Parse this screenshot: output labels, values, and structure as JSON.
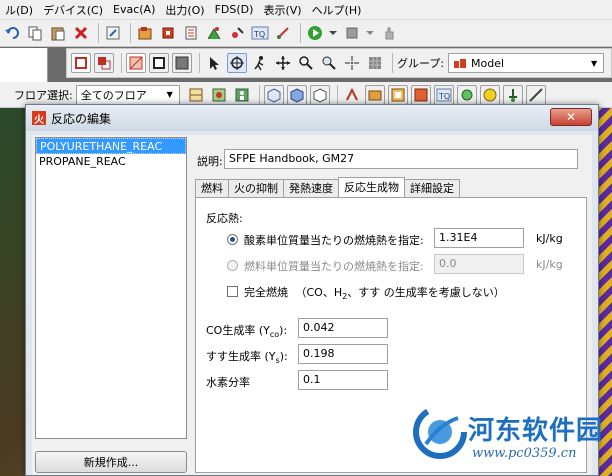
{
  "menu": [
    "ル(D)",
    "デバイス(C)",
    "Evac(A)",
    "出力(O)",
    "FDS(D)",
    "表示(V)",
    "ヘルプ(H)"
  ],
  "toolbar2": {
    "group_label": "グループ:",
    "group_value": "Model"
  },
  "toolbar3": {
    "floor_label": "フロア選択:",
    "floor_value": "全てのフロア"
  },
  "dialog": {
    "title": "反応の編集",
    "close": "✕",
    "reactions": [
      "POLYURETHANE_REAC",
      "PROPANE_REAC"
    ],
    "new_button": "新規作成...",
    "description_label": "説明:",
    "description_value": "SFPE Handbook, GM27",
    "tabs": [
      "燃料",
      "火の抑制",
      "発熱速度",
      "反応生成物",
      "詳細設定"
    ],
    "active_tab": 3,
    "heat_label": "反応熱:",
    "oxygen_option": "酸素単位質量当たりの燃焼熱を指定:",
    "oxygen_value": "1.31E4",
    "oxygen_unit": "kJ/kg",
    "fuel_option": "燃料単位質量当たりの燃焼熱を指定:",
    "fuel_value": "0.0",
    "fuel_unit": "kJ/kg",
    "complete_label": "完全燃焼",
    "complete_note_a": "（CO、H",
    "complete_note_sub": "2",
    "complete_note_b": "、すす の生成率を考慮しない）",
    "co_label": "CO生成率 (Y",
    "co_sub": "co",
    "co_end": "):",
    "co_value": "0.042",
    "soot_label": "すす生成率 (Y",
    "soot_sub": "s",
    "soot_end": "):",
    "soot_value": "0.198",
    "hydrogen_label": "水素分率",
    "hydrogen_value": "0.1"
  },
  "watermark": {
    "name": "河东软件园",
    "url": "www.pc0359.cn"
  }
}
